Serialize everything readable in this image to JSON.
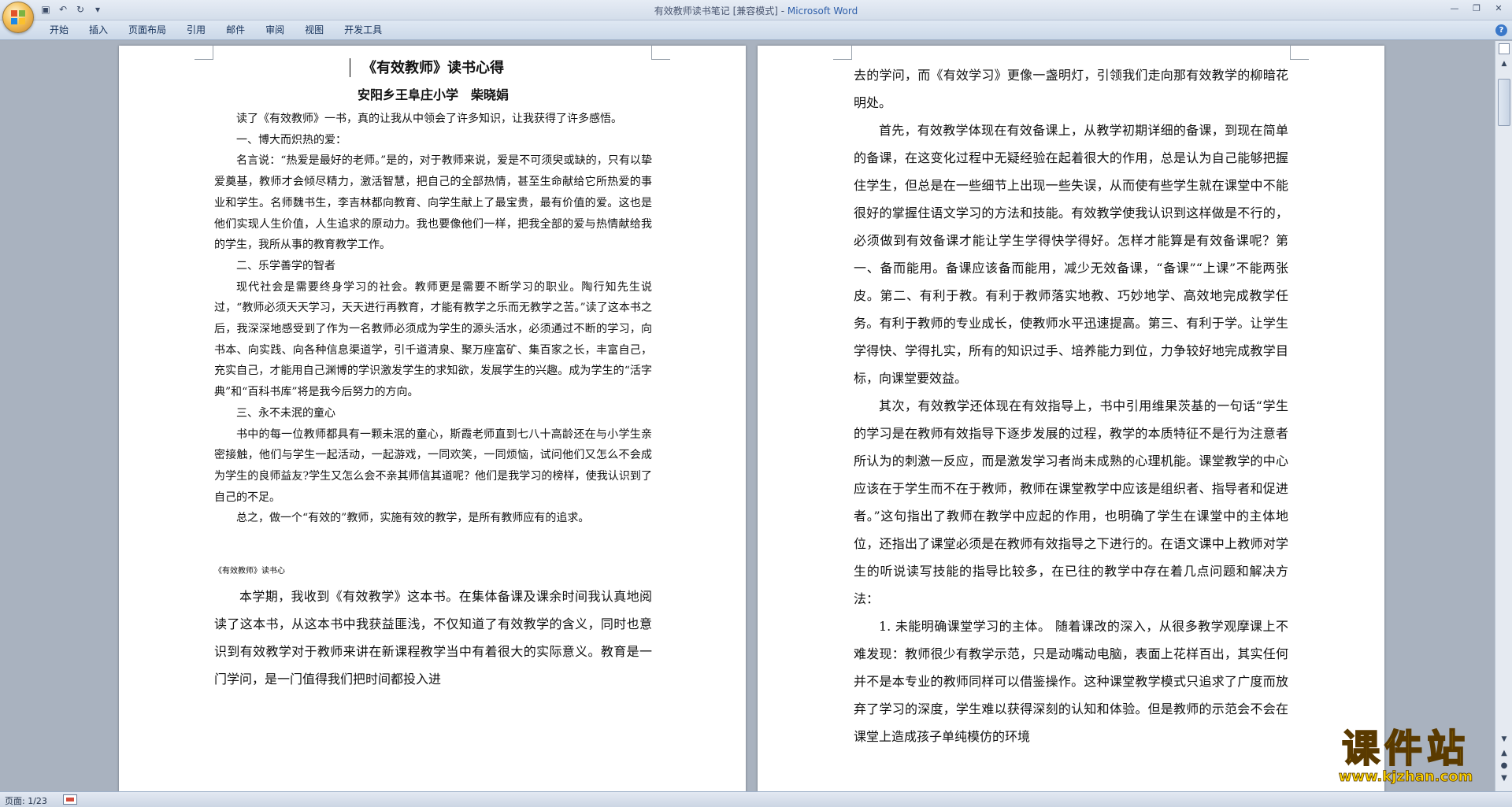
{
  "window": {
    "title": "有效教师读书笔记 [兼容模式] - ",
    "app_name": "Microsoft Word"
  },
  "ribbon": {
    "tabs": [
      "开始",
      "插入",
      "页面布局",
      "引用",
      "邮件",
      "审阅",
      "视图",
      "开发工具"
    ]
  },
  "page1": {
    "title": "《有效教师》读书心得",
    "subtitle": "安阳乡王阜庄小学　柴晓娟",
    "paragraphs": [
      "读了《有效教师》一书，真的让我从中领会了许多知识，让我获得了许多感悟。",
      "一、博大而炽热的爱：",
      "名言说：“热爱是最好的老师。”是的，对于教师来说，爱是不可须臾或缺的，只有以挚爱奠基，教师才会倾尽精力，激活智慧，把自己的全部热情，甚至生命献给它所热爱的事业和学生。名师魏书生，李吉林都向教育、向学生献上了最宝贵，最有价值的爱。这也是他们实现人生价值，人生追求的原动力。我也要像他们一样，把我全部的爱与热情献给我的学生，我所从事的教育教学工作。",
      "二、乐学善学的智者",
      "现代社会是需要终身学习的社会。教师更是需要不断学习的职业。陶行知先生说过，“教师必须天天学习，天天进行再教育，才能有教学之乐而无教学之苦。”读了这本书之后，我深深地感受到了作为一名教师必须成为学生的源头活水，必须通过不断的学习，向书本、向实践、向各种信息渠道学，引千道清泉、聚万座富矿、集百家之长，丰富自己，充实自己，才能用自己渊博的学识激发学生的求知欲，发展学生的兴趣。成为学生的“活字典”和“百科书库”将是我今后努力的方向。",
      "三、永不未泯的童心",
      "书中的每一位教师都具有一颗未泯的童心，斯霞老师直到七八十高龄还在与小学生亲密接触，他们与学生一起活动，一起游戏，一同欢笑，一同烦恼，试问他们又怎么不会成为学生的良师益友?学生又怎么会不亲其师信其道呢？他们是我学习的榜样，使我认识到了自己的不足。",
      "总之，做一个“有效的”教师，实施有效的教学，是所有教师应有的追求。"
    ],
    "second_title": "《有效教师》读书心",
    "second_paragraph": "本学期，我收到《有效教学》这本书。在集体备课及课余时间我认真地阅读了这本书，从这本书中我获益匪浅，不仅知道了有效教学的含义，同时也意识到有效教学对于教师来讲在新课程教学当中有着很大的实际意义。教育是一门学问，是一门值得我们把时间都投入进"
  },
  "page2": {
    "paragraphs": [
      "去的学问，而《有效学习》更像一盏明灯，引领我们走向那有效教学的柳暗花明处。",
      "首先，有效教学体现在有效备课上，从教学初期详细的备课，到现在简单的备课，在这变化过程中无疑经验在起着很大的作用，总是认为自己能够把握住学生，但总是在一些细节上出现一些失误，从而使有些学生就在课堂中不能很好的掌握住语文学习的方法和技能。有效教学使我认识到这样做是不行的，必须做到有效备课才能让学生学得快学得好。怎样才能算是有效备课呢？第一、备而能用。备课应该备而能用，减少无效备课，“备课”“上课”不能两张皮。第二、有利于教。有利于教师落实地教、巧妙地学、高效地完成教学任务。有利于教师的专业成长，使教师水平迅速提高。第三、有利于学。让学生学得快、学得扎实，所有的知识过手、培养能力到位，力争较好地完成教学目标，向课堂要效益。",
      "其次，有效教学还体现在有效指导上，书中引用维果茨基的一句话“学生的学习是在教师有效指导下逐步发展的过程，教学的本质特征不是行为注意者所认为的刺激一反应，而是激发学习者尚未成熟的心理机能。课堂教学的中心应该在于学生而不在于教师，教师在课堂教学中应该是组织者、指导者和促进者。”这句指出了教师在教学中应起的作用，也明确了学生在课堂中的主体地位，还指出了课堂必须是在教师有效指导之下进行的。在语文课中上教师对学生的听说读写技能的指导比较多，在已往的教学中存在着几点问题和解决方法：",
      "1. 未能明确课堂学习的主体。 随着课改的深入，从很多教学观摩课上不难发现：教师很少有教学示范，只是动嘴动电脑，表面上花样百出，其实任何并不是本专业的教师同样可以借鉴操作。这种课堂教学模式只追求了广度而放弃了学习的深度，学生难以获得深刻的认知和体验。但是教师的示范会不会在课堂上造成孩子单纯模仿的环境"
    ]
  },
  "status": {
    "page_info": "页面: 1/23"
  },
  "watermark": {
    "text": "课件站",
    "url": "www.kjzhan.com"
  }
}
